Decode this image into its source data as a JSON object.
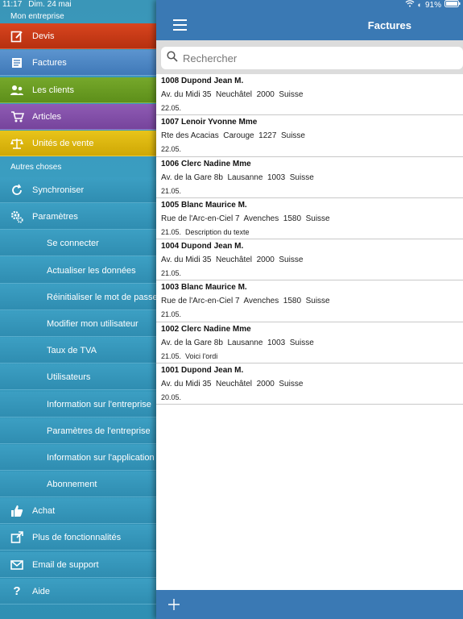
{
  "status": {
    "time": "11:17",
    "date": "Dim. 24 mai",
    "battery": "91%"
  },
  "sidebar": {
    "section1": "Mon entreprise",
    "section2": "Autres choses",
    "primary": [
      {
        "label": "Devis",
        "icon": "edit-icon"
      },
      {
        "label": "Factures",
        "icon": "invoice-icon"
      },
      {
        "label": "Les clients",
        "icon": "clients-icon"
      },
      {
        "label": "Articles",
        "icon": "cart-icon"
      },
      {
        "label": "Unités de vente",
        "icon": "scale-icon"
      }
    ],
    "other": [
      {
        "label": "Synchroniser",
        "icon": "sync-icon"
      },
      {
        "label": "Paramètres",
        "icon": "gear-icon"
      }
    ],
    "settings": [
      "Se connecter",
      "Actualiser les données",
      "Réinitialiser le mot de passe",
      "Modifier mon utilisateur",
      "Taux de TVA",
      "Utilisateurs",
      "Information sur l'entreprise",
      "Paramètres de l'entreprise",
      "Information sur l'application",
      "Abonnement"
    ],
    "bottom": [
      {
        "label": "Achat",
        "icon": "thumbs-up-icon"
      },
      {
        "label": "Plus de fonctionnalités",
        "icon": "external-link-icon"
      },
      {
        "label": "Email de support",
        "icon": "mail-icon"
      },
      {
        "label": "Aide",
        "icon": "help-icon"
      }
    ]
  },
  "header": {
    "title": "Factures"
  },
  "search": {
    "placeholder": "Rechercher"
  },
  "invoices": [
    {
      "title": "1008 Dupond Jean M.",
      "address": "Av. du Midi 35  Neuchâtel  2000  Suisse",
      "meta": "22.05."
    },
    {
      "title": "1007 Lenoir Yvonne Mme",
      "address": "Rte des Acacias  Carouge  1227  Suisse",
      "meta": "22.05."
    },
    {
      "title": "1006 Clerc Nadine Mme",
      "address": "Av. de la Gare 8b  Lausanne  1003  Suisse",
      "meta": "21.05."
    },
    {
      "title": "1005 Blanc Maurice M.",
      "address": "Rue de l'Arc-en-Ciel 7  Avenches  1580  Suisse",
      "meta": "21.05.  Description du texte"
    },
    {
      "title": "1004 Dupond Jean M.",
      "address": "Av. du Midi 35  Neuchâtel  2000  Suisse",
      "meta": "21.05."
    },
    {
      "title": "1003 Blanc Maurice M.",
      "address": "Rue de l'Arc-en-Ciel 7  Avenches  1580  Suisse",
      "meta": "21.05."
    },
    {
      "title": "1002 Clerc Nadine Mme",
      "address": "Av. de la Gare 8b  Lausanne  1003  Suisse",
      "meta": "21.05.  Voici l'ordi"
    },
    {
      "title": "1001 Dupond Jean M.",
      "address": "Av. du Midi 35  Neuchâtel  2000  Suisse",
      "meta": "20.05."
    }
  ],
  "colors": {
    "header": "#3a79b4",
    "sidebar": "#3a9bbd"
  }
}
